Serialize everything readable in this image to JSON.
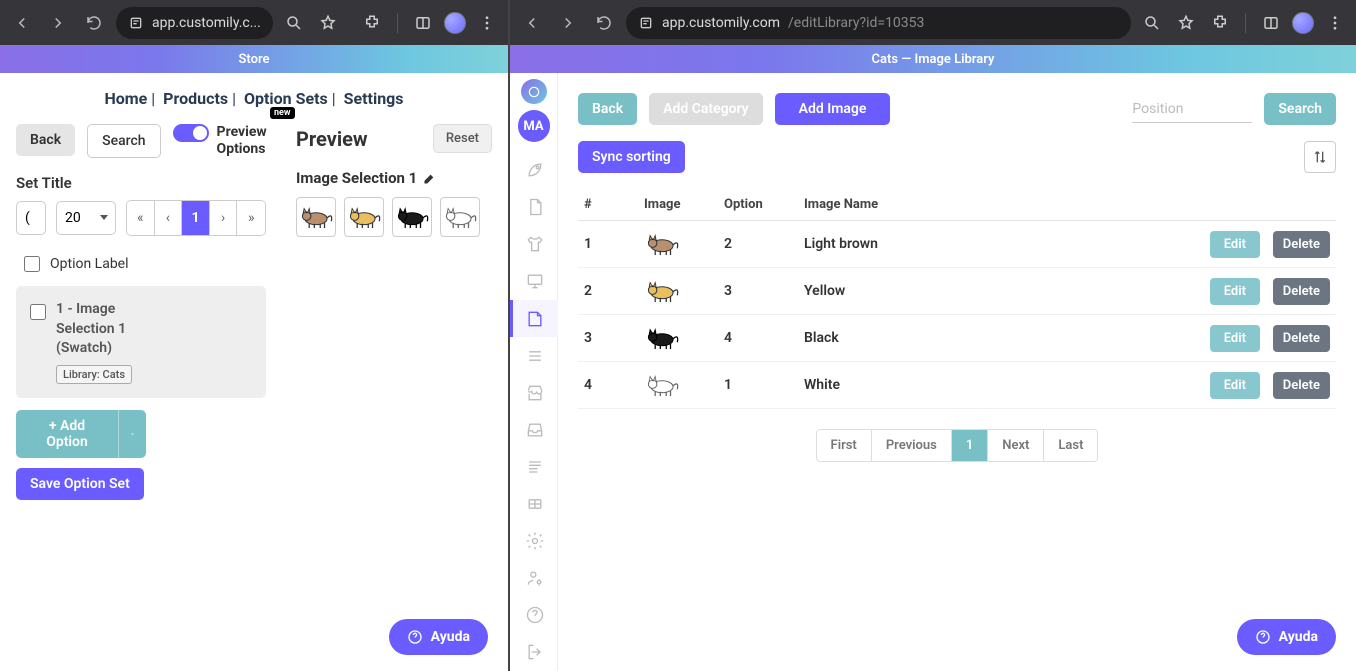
{
  "left": {
    "url_short": "app.customily.c...",
    "app_bar_title": "Store",
    "breadcrumbs": [
      "Home",
      "Products",
      "Option Sets",
      "Settings"
    ],
    "badge_new": "new",
    "back_btn": "Back",
    "search_btn": "Search",
    "preview_toggle": "Preview Options",
    "set_title_label": "Set Title",
    "set_title_value": "(",
    "page_size": "20",
    "pager": {
      "first": "«",
      "prev": "‹",
      "page": "1",
      "next": "›",
      "last": "»"
    },
    "option_label_text": "Option Label",
    "option_card_text": "1 - Image Selection 1 (Swatch)",
    "library_badge": "Library: Cats",
    "add_option": "+ Add Option",
    "save_option_set": "Save Option Set",
    "preview_title": "Preview",
    "reset_btn": "Reset",
    "image_selection_label": "Image Selection 1",
    "help_label": "Ayuda"
  },
  "right": {
    "url_host": "app.customily.com",
    "url_path": "/editLibrary?id=10353",
    "app_bar_title": "Cats — Image Library",
    "avatar": "MA",
    "back_btn": "Back",
    "add_category": "Add Category",
    "add_image": "Add Image",
    "position_placeholder": "Position",
    "search_btn": "Search",
    "sync_sorting": "Sync sorting",
    "columns": {
      "idx": "#",
      "image": "Image",
      "option": "Option",
      "name": "Image Name"
    },
    "rows": [
      {
        "idx": "1",
        "option": "2",
        "name": "Light brown",
        "color": "brown"
      },
      {
        "idx": "2",
        "option": "3",
        "name": "Yellow",
        "color": "yellow"
      },
      {
        "idx": "3",
        "option": "4",
        "name": "Black",
        "color": "black"
      },
      {
        "idx": "4",
        "option": "1",
        "name": "White",
        "color": "white"
      }
    ],
    "edit_btn": "Edit",
    "delete_btn": "Delete",
    "pager": {
      "first": "First",
      "prev": "Previous",
      "page": "1",
      "next": "Next",
      "last": "Last"
    },
    "help_label": "Ayuda"
  },
  "cat_svgs": {
    "brown": "#b89070",
    "yellow": "#e8c060",
    "black": "#1a1a1a",
    "white": "#ffffff"
  }
}
